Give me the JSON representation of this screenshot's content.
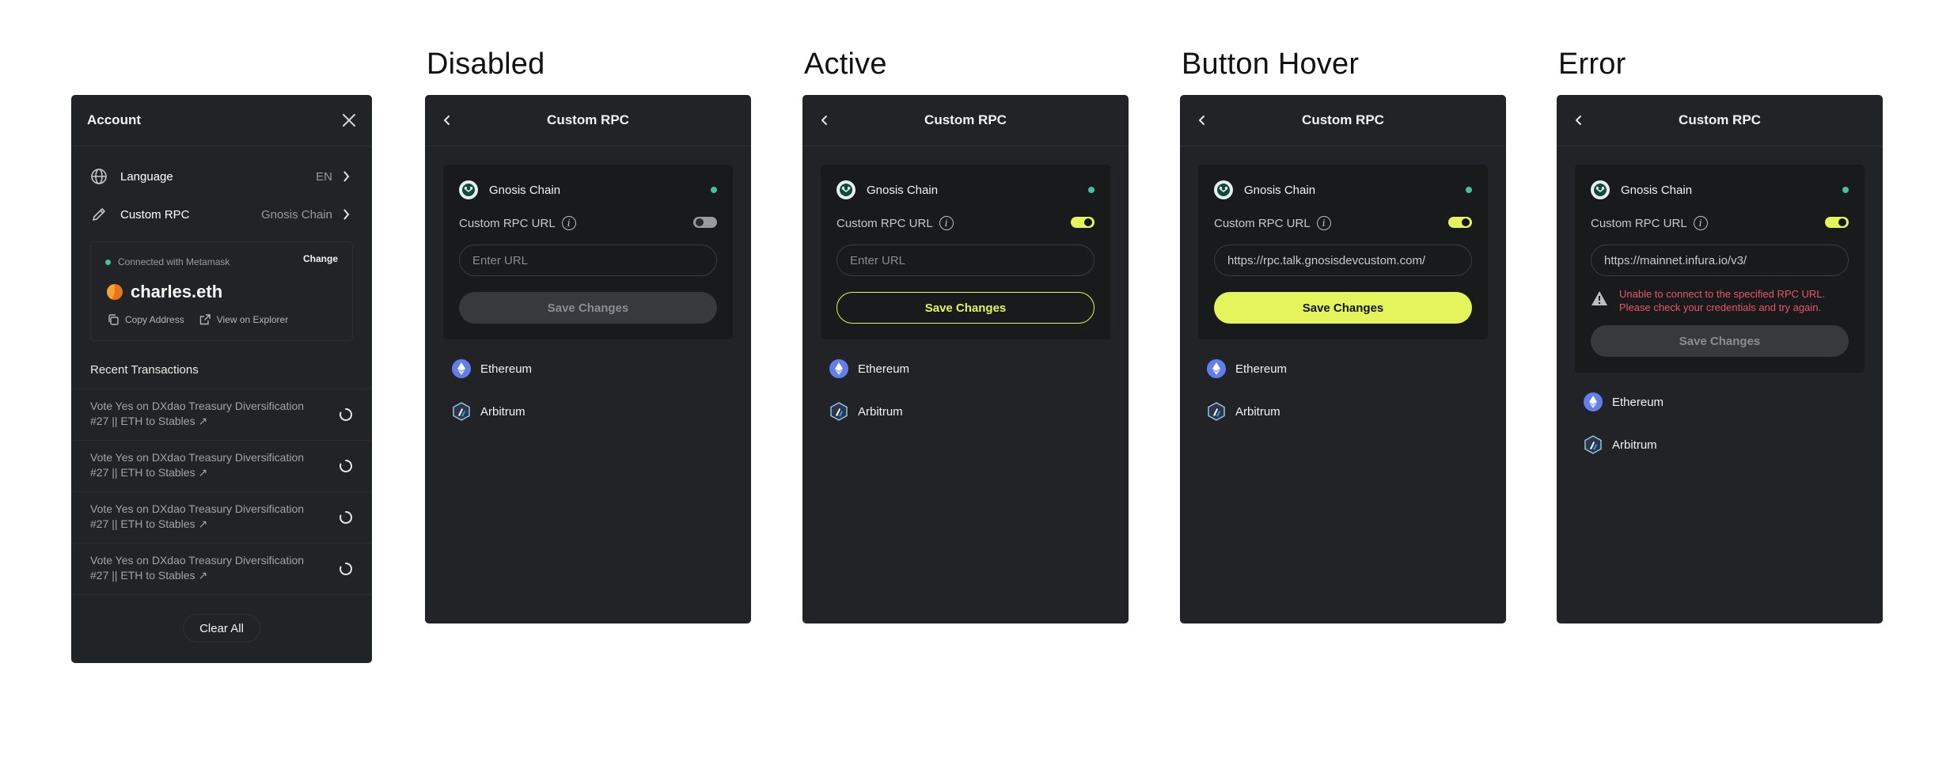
{
  "colors": {
    "accent": "#e3f55a",
    "panel": "#222326",
    "card": "#191a1c",
    "connected": "#3fc3a0",
    "error": "#e5566f"
  },
  "account": {
    "title": "Account",
    "language_label": "Language",
    "language_value": "EN",
    "rpc_label": "Custom RPC",
    "rpc_value": "Gnosis Chain",
    "connected_text": "Connected with Metamask",
    "change_label": "Change",
    "ens_name": "charles.eth",
    "copy_label": "Copy Address",
    "explorer_label": "View on Explorer",
    "recent_title": "Recent Transactions",
    "transactions": [
      {
        "line1": "Vote Yes on DXdao Treasury Diversification",
        "line2": "#27 || ETH to Stables ↗"
      },
      {
        "line1": "Vote Yes on DXdao Treasury Diversification",
        "line2": "#27 || ETH to Stables ↗"
      },
      {
        "line1": "Vote Yes on DXdao Treasury Diversification",
        "line2": "#27 || ETH to Stables ↗"
      },
      {
        "line1": "Vote Yes on DXdao Treasury Diversification",
        "line2": "#27 || ETH to Stables ↗"
      }
    ],
    "clear_label": "Clear All"
  },
  "states": [
    {
      "title": "Disabled",
      "header": "Custom RPC",
      "chain": "Gnosis Chain",
      "url_label": "Custom RPC URL",
      "toggle_on": false,
      "url_value": "",
      "url_placeholder": "Enter URL",
      "button": "Save Changes",
      "button_state": "disabled",
      "error": ""
    },
    {
      "title": "Active",
      "header": "Custom RPC",
      "chain": "Gnosis Chain",
      "url_label": "Custom RPC URL",
      "toggle_on": true,
      "url_value": "",
      "url_placeholder": "Enter URL",
      "button": "Save Changes",
      "button_state": "active",
      "error": ""
    },
    {
      "title": "Button Hover",
      "header": "Custom RPC",
      "chain": "Gnosis Chain",
      "url_label": "Custom RPC URL",
      "toggle_on": true,
      "url_value": "https://rpc.talk.gnosisdevcustom.com/",
      "url_placeholder": "",
      "button": "Save Changes",
      "button_state": "hover",
      "error": ""
    },
    {
      "title": "Error",
      "header": "Custom RPC",
      "chain": "Gnosis Chain",
      "url_label": "Custom RPC URL",
      "toggle_on": true,
      "url_value": "https://mainnet.infura.io/v3/",
      "url_placeholder": "",
      "button": "Save Changes",
      "button_state": "disabled",
      "error": "Unable to connect to the specified RPC URL. Please check your credentials and try again.",
      "error_line1": "Unable to connect to the specified RPC URL.",
      "error_line2": "Please check your credentials and try again."
    }
  ],
  "networks": [
    "Ethereum",
    "Arbitrum"
  ]
}
